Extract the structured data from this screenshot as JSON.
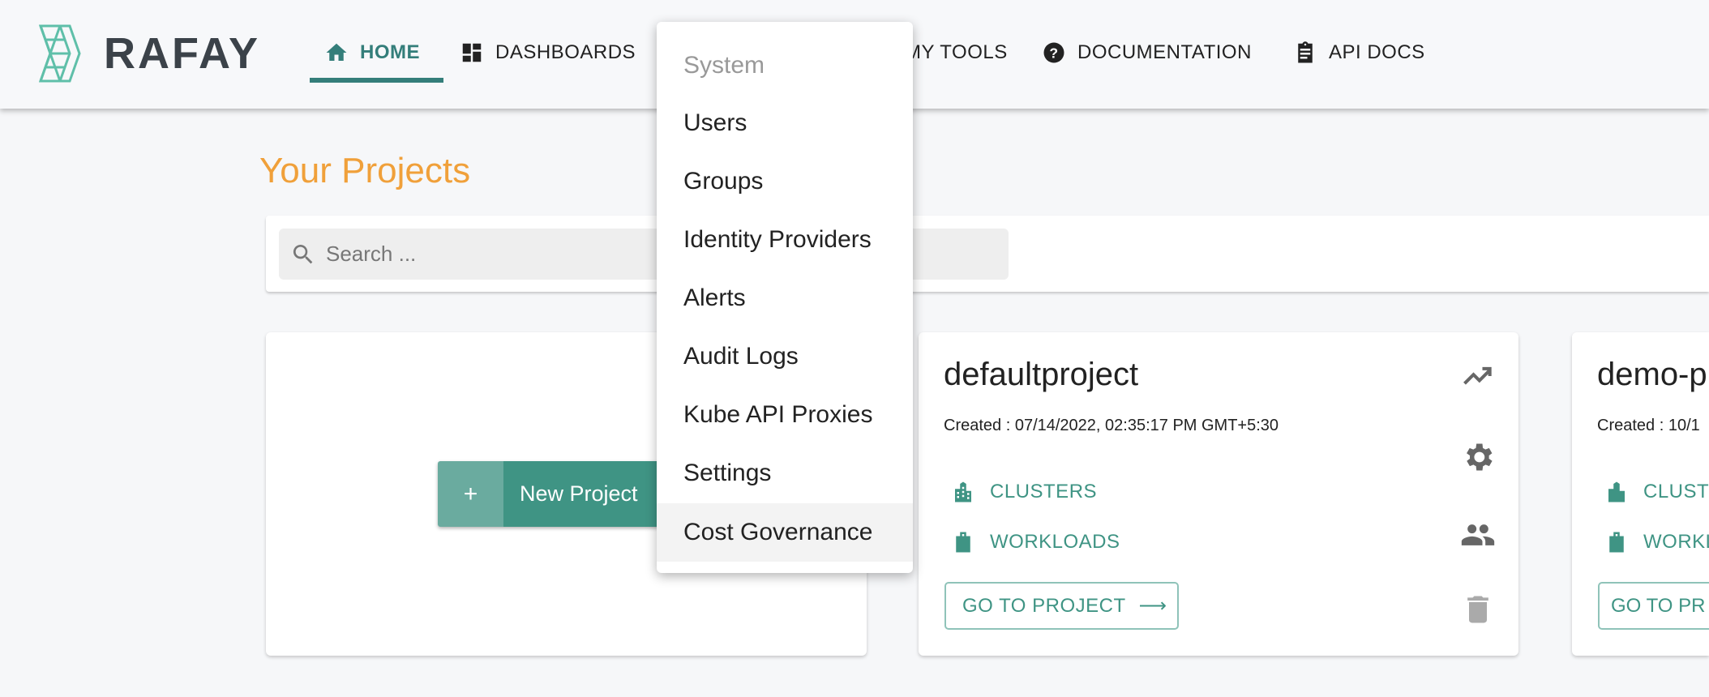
{
  "header": {
    "logo_text": "RAFAY",
    "nav": [
      {
        "label": "HOME",
        "icon": "home-icon"
      },
      {
        "label": "DASHBOARDS",
        "icon": "dashboard-icon"
      },
      {
        "label": "MY TOOLS",
        "icon": "tools-icon"
      },
      {
        "label": "DOCUMENTATION",
        "icon": "help-icon"
      },
      {
        "label": "API DOCS",
        "icon": "clipboard-icon"
      }
    ]
  },
  "page": {
    "title": "Your Projects",
    "search_placeholder": "Search ..."
  },
  "new_project": {
    "plus": "+",
    "label": "New Project"
  },
  "projects": [
    {
      "name": "defaultproject",
      "created": "Created : 07/14/2022, 02:35:17 PM GMT+5:30",
      "clusters": "CLUSTERS",
      "workloads": "WORKLOADS",
      "go": "GO TO PROJECT",
      "arrow": "⟶"
    },
    {
      "name": "demo-pr",
      "created": "Created : 10/1",
      "clusters": "CLUST",
      "workloads": "WORKL",
      "go": "GO TO PR"
    }
  ],
  "menu": {
    "header": "System",
    "items": [
      "Users",
      "Groups",
      "Identity Providers",
      "Alerts",
      "Audit Logs",
      "Kube API Proxies",
      "Settings",
      "Cost Governance"
    ],
    "highlighted": "Cost Governance"
  },
  "colors": {
    "accent": "#3f9484",
    "nav_active": "#347e7a",
    "title": "#f0a03a"
  }
}
